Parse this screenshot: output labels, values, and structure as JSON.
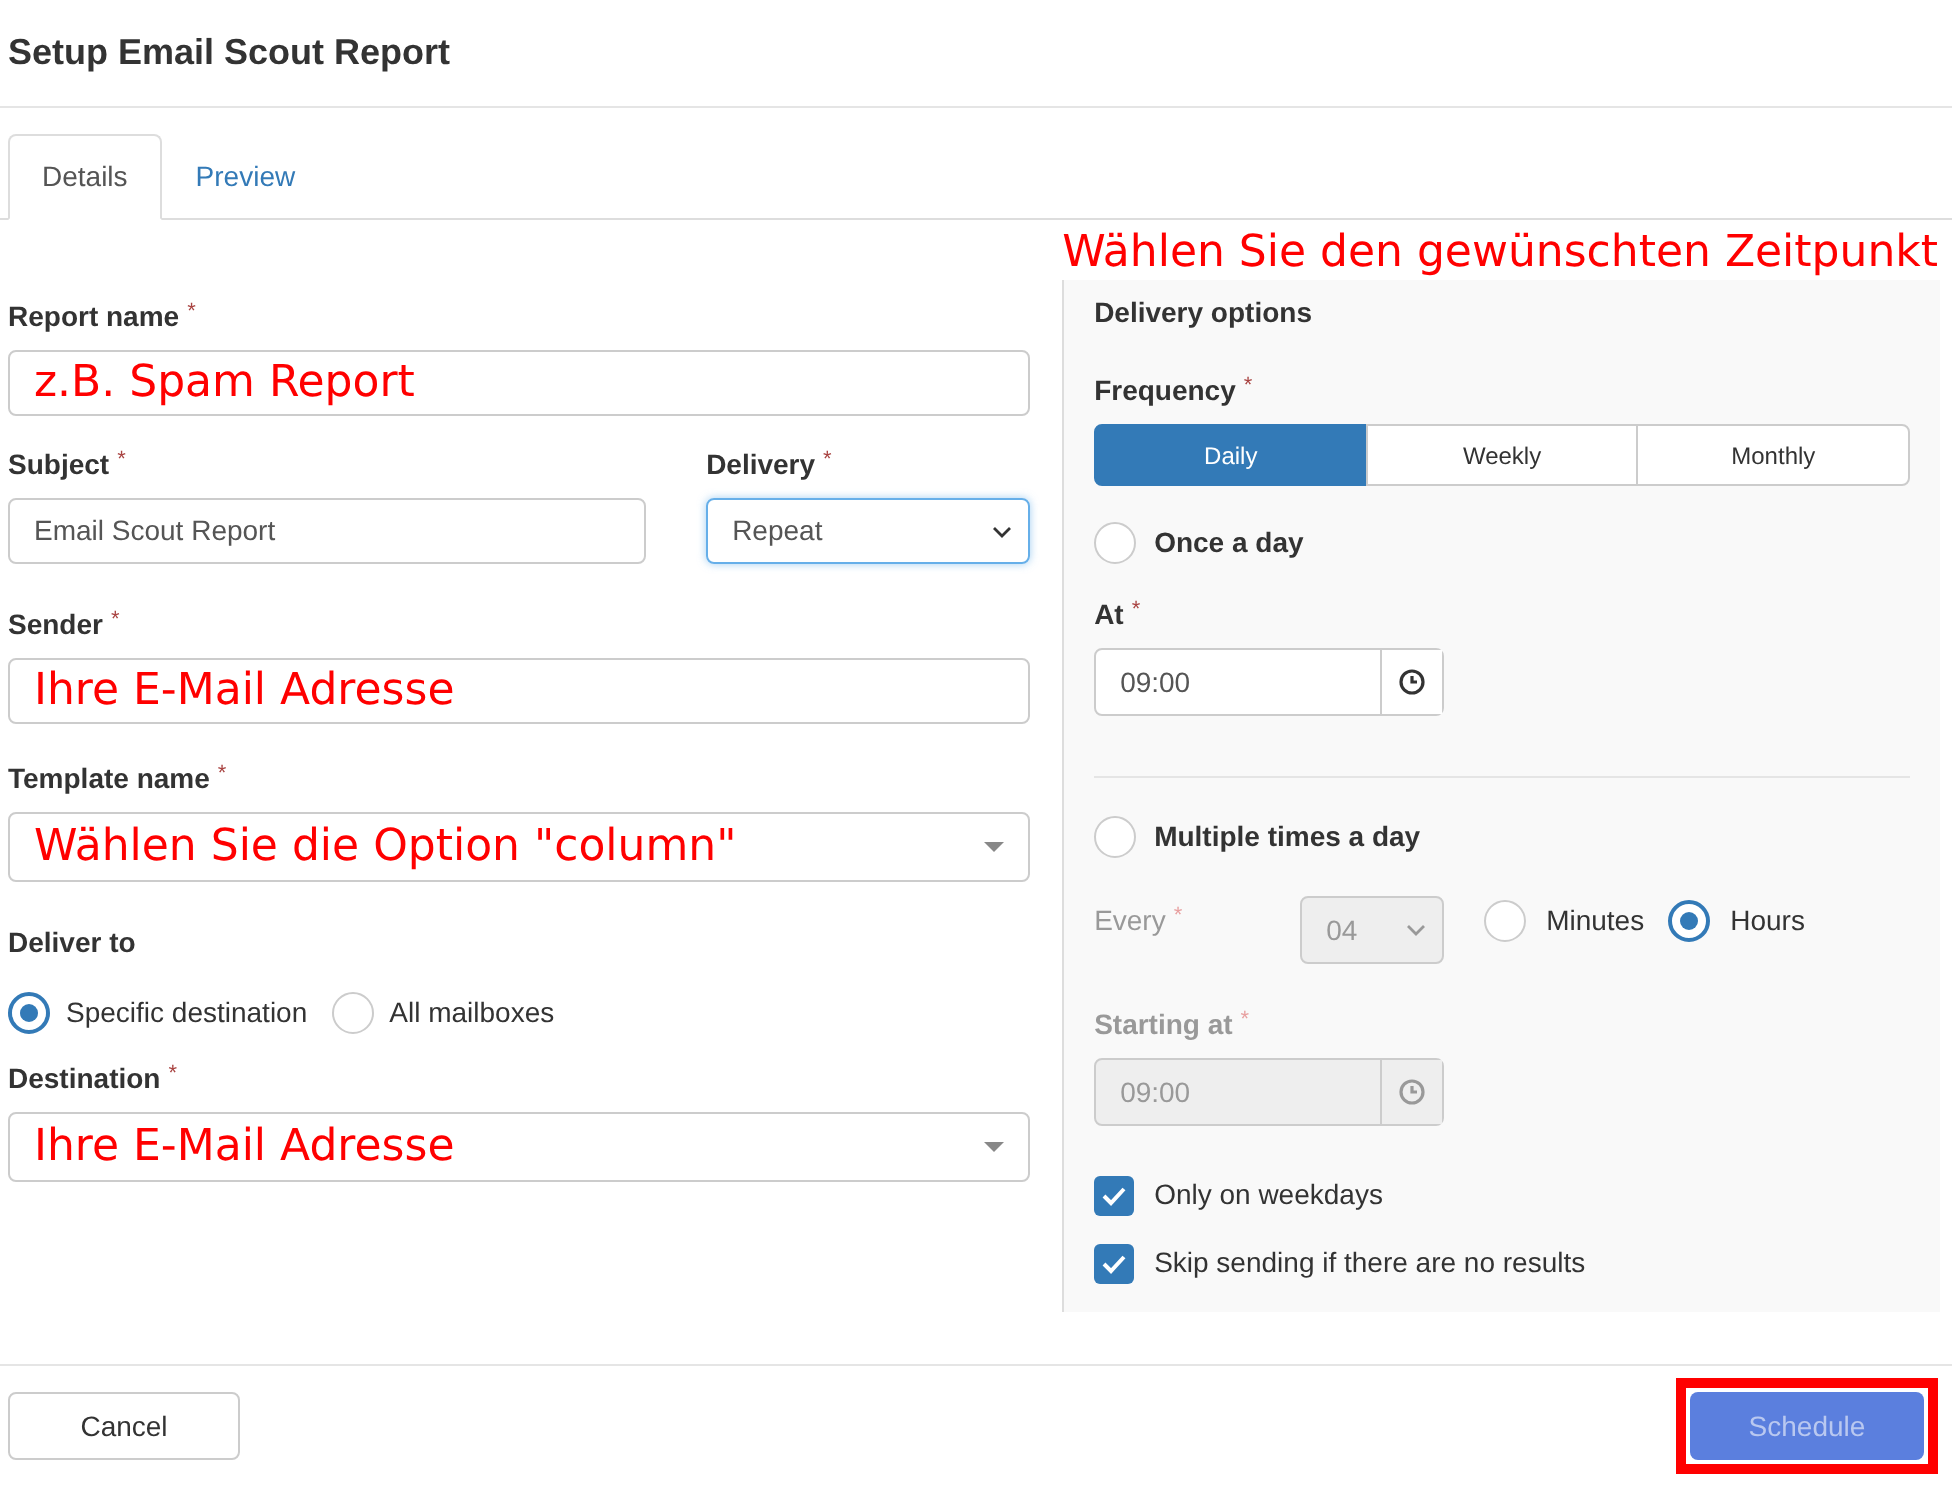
{
  "window": {
    "title": "Setup Email Scout Report"
  },
  "tabs": [
    {
      "label": "Details",
      "selected": true
    },
    {
      "label": "Preview",
      "selected": false
    }
  ],
  "annotation": "Wählen Sie den gewünschten Zeitpunkt",
  "form": {
    "report_name": {
      "label": "Report name",
      "mark": "*",
      "value": "z.B. Spam Report",
      "annotated": true
    },
    "subject": {
      "label": "Subject",
      "mark": "*",
      "value": "Email Scout Report",
      "annotated": false
    },
    "delivery": {
      "label": "Delivery",
      "mark": "*",
      "value": "Repeat",
      "focused": true
    },
    "sender": {
      "label": "Sender",
      "mark": "*",
      "value": "Ihre E-Mail Adresse",
      "annotated": true
    },
    "template_name": {
      "label": "Template name",
      "mark": "*",
      "value": "Wählen Sie die Option \"column\"",
      "annotated": true
    },
    "deliver_to": {
      "label": "Deliver to",
      "options": [
        {
          "label": "Specific destination",
          "selected": true
        },
        {
          "label": "All mailboxes",
          "selected": false
        }
      ]
    },
    "destination": {
      "label": "Destination",
      "mark": "*",
      "value": "Ihre E-Mail Adresse",
      "annotated": true
    }
  },
  "delivery_options": {
    "title": "Delivery options",
    "frequency": {
      "label": "Frequency",
      "mark": "*",
      "options": [
        {
          "label": "Daily",
          "selected": true
        },
        {
          "label": "Weekly",
          "selected": false
        },
        {
          "label": "Monthly",
          "selected": false
        }
      ]
    },
    "once_a_day": {
      "label": "Once a day",
      "selected": false
    },
    "at": {
      "label": "At",
      "mark": "*",
      "value": "09:00",
      "disabled": false
    },
    "multiple_times": {
      "label": "Multiple times a day",
      "selected": false
    },
    "every": {
      "label": "Every",
      "mark": "*",
      "value": "04",
      "disabled": true,
      "units": [
        {
          "label": "Minutes",
          "selected": false
        },
        {
          "label": "Hours",
          "selected": true
        }
      ]
    },
    "starting_at": {
      "label": "Starting at",
      "mark": "*",
      "value": "09:00",
      "disabled": true
    },
    "checkboxes": [
      {
        "label": "Only on weekdays",
        "checked": true
      },
      {
        "label": "Skip sending if there are no results",
        "checked": true
      }
    ]
  },
  "buttons": [
    {
      "label": "Cancel",
      "kind": "default"
    },
    {
      "label": "Schedule",
      "kind": "primary",
      "highlighted": true
    }
  ]
}
